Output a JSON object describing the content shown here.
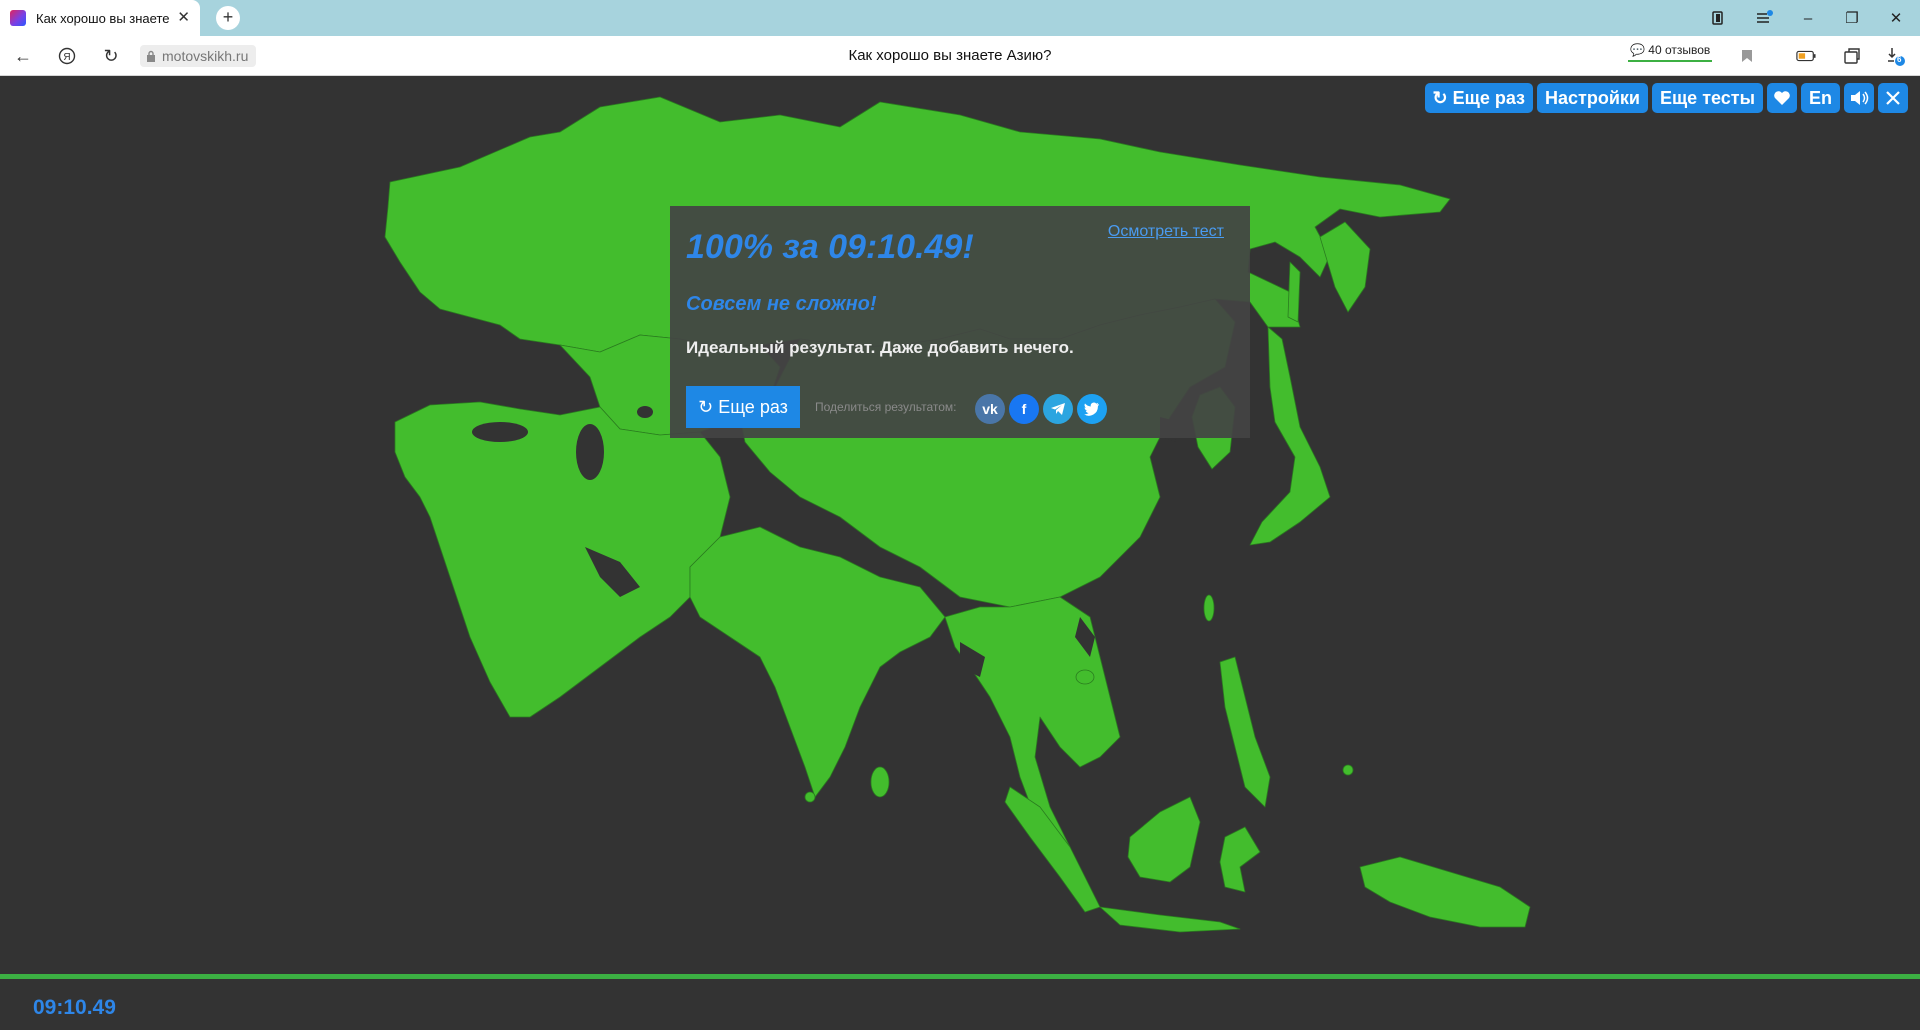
{
  "browser": {
    "tab_title": "Как хорошо вы знаете",
    "url": "motovskikh.ru",
    "page_title": "Как хорошо вы знаете Азию?",
    "reviews_label": "40 отзывов",
    "downloads_badge": "6"
  },
  "toolbar": {
    "retry_label": "↻ Еще раз",
    "settings_label": "Настройки",
    "more_tests_label": "Еще тесты",
    "lang_label": "En"
  },
  "result": {
    "score": "100% за 09:10.49!",
    "review_link": "Осмотреть тест",
    "verdict": "Совсем не сложно!",
    "comment": "Идеальный результат. Даже добавить нечего.",
    "retry_label": "↻ Еще раз",
    "share_label": "Поделиться результатом:",
    "share_buttons": [
      "vk",
      "f",
      "telegram",
      "twitter"
    ]
  },
  "timer": "09:10.49",
  "progress": 1.0,
  "colors": {
    "accent": "#1e88e5",
    "map_green": "#43bd2d",
    "background": "#333333"
  }
}
